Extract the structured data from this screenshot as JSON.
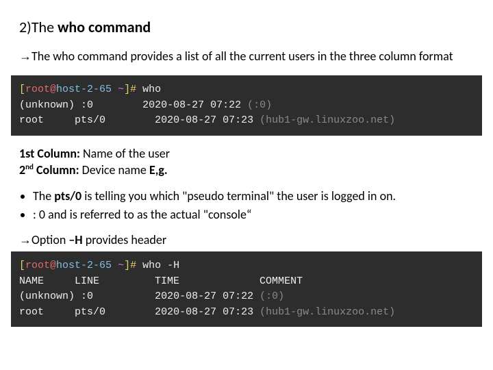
{
  "heading": {
    "prefix": "2)",
    "text_pre": "The ",
    "text_bold": "who command"
  },
  "intro": {
    "arrow": "→",
    "text": "The who command provides a list of all the current users in the three column format"
  },
  "term1": {
    "prompt": {
      "open": "[",
      "user": "root",
      "at": "@",
      "host": "host-2-65 ",
      "path": "~",
      "close": "]",
      "sym": "# "
    },
    "cmd": "who",
    "l1": {
      "name": "(unknown)",
      "sp1": " ",
      "tty": ":0",
      "sp2": "        ",
      "time": "2020-08-27 07:22",
      "note": " (:0)"
    },
    "l2": {
      "name": "root",
      "sp1": "     ",
      "tty": "pts/0",
      "sp2": "        ",
      "time": "2020-08-27 07:23",
      "note": " (hub1-gw.linuxzoo.net)"
    }
  },
  "cols": {
    "c1_lbl": "1st Column:",
    "c1_val": " Name of the user",
    "c2_lbl_a": "2",
    "c2_lbl_sup": "nd",
    "c2_lbl_b": " Column:",
    "c2_val": " Device name ",
    "c2_eg": "E,g."
  },
  "bullets": {
    "b1_a": "The ",
    "b1_b": "pts/0 ",
    "b1_c": "is telling you which \"pseudo terminal\" the user is logged in on.",
    "b2": ": 0 and is referred to as the actual \"console“"
  },
  "opt": {
    "arrow": "→",
    "a": "Option ",
    "b": "–H ",
    "c": "provides header"
  },
  "term2": {
    "prompt": {
      "open": "[",
      "user": "root",
      "at": "@",
      "host": "host-2-65 ",
      "path": "~",
      "close": "]",
      "sym": "# "
    },
    "cmd": "who -H",
    "hdr": "NAME     LINE         TIME             COMMENT",
    "l1": {
      "name": "(unknown)",
      "sp1": " ",
      "tty": ":0",
      "sp2": "          ",
      "time": "2020-08-27 07:22",
      "note": " (:0)"
    },
    "l2": {
      "name": "root",
      "sp1": "     ",
      "tty": "pts/0",
      "sp2": "        ",
      "time": "2020-08-27 07:23",
      "note": " (hub1-gw.linuxzoo.net)"
    }
  }
}
